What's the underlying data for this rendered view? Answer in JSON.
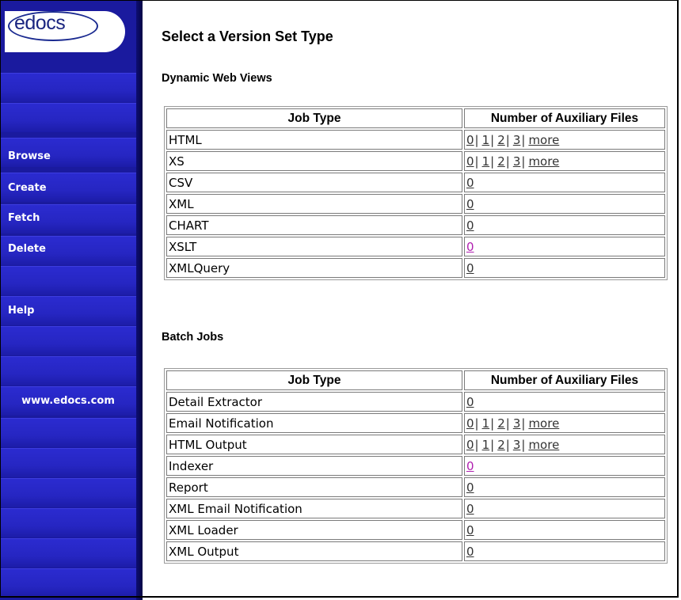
{
  "logo": {
    "text": "edocs"
  },
  "sidebar": {
    "items": [
      {
        "label": "Browse"
      },
      {
        "label": "Create"
      },
      {
        "label": "Fetch"
      },
      {
        "label": "Delete"
      },
      {
        "label": "Help"
      }
    ],
    "site_link": "www.edocs.com"
  },
  "page": {
    "title": "Select a Version Set Type"
  },
  "dynamic": {
    "section_title": "Dynamic Web Views",
    "headers": {
      "type": "Job Type",
      "aux": "Number of Auxiliary Files"
    },
    "rows": [
      {
        "type": "HTML",
        "links": [
          "0",
          "1",
          "2",
          "3",
          "more"
        ]
      },
      {
        "type": "XS",
        "links": [
          "0",
          "1",
          "2",
          "3",
          "more"
        ]
      },
      {
        "type": "CSV",
        "links": [
          "0"
        ]
      },
      {
        "type": "XML",
        "links": [
          "0"
        ]
      },
      {
        "type": "CHART",
        "links": [
          "0"
        ]
      },
      {
        "type": "XSLT",
        "links": [
          "0"
        ],
        "visited": true
      },
      {
        "type": "XMLQuery",
        "links": [
          "0"
        ]
      }
    ]
  },
  "batch": {
    "section_title": "Batch Jobs",
    "headers": {
      "type": "Job Type",
      "aux": "Number of Auxiliary Files"
    },
    "rows": [
      {
        "type": "Detail Extractor",
        "links": [
          "0"
        ]
      },
      {
        "type": "Email Notification",
        "links": [
          "0",
          "1",
          "2",
          "3",
          "more"
        ]
      },
      {
        "type": "HTML Output",
        "links": [
          "0",
          "1",
          "2",
          "3",
          "more"
        ]
      },
      {
        "type": "Indexer",
        "links": [
          "0"
        ],
        "visited": true
      },
      {
        "type": "Report",
        "links": [
          "0"
        ]
      },
      {
        "type": "XML Email Notification",
        "links": [
          "0"
        ]
      },
      {
        "type": "XML Loader",
        "links": [
          "0"
        ]
      },
      {
        "type": "XML Output",
        "links": [
          "0"
        ]
      }
    ]
  },
  "colors": {
    "sidebar": "#1a1a9e",
    "link": "#333333",
    "visited_link": "#b020b0"
  }
}
